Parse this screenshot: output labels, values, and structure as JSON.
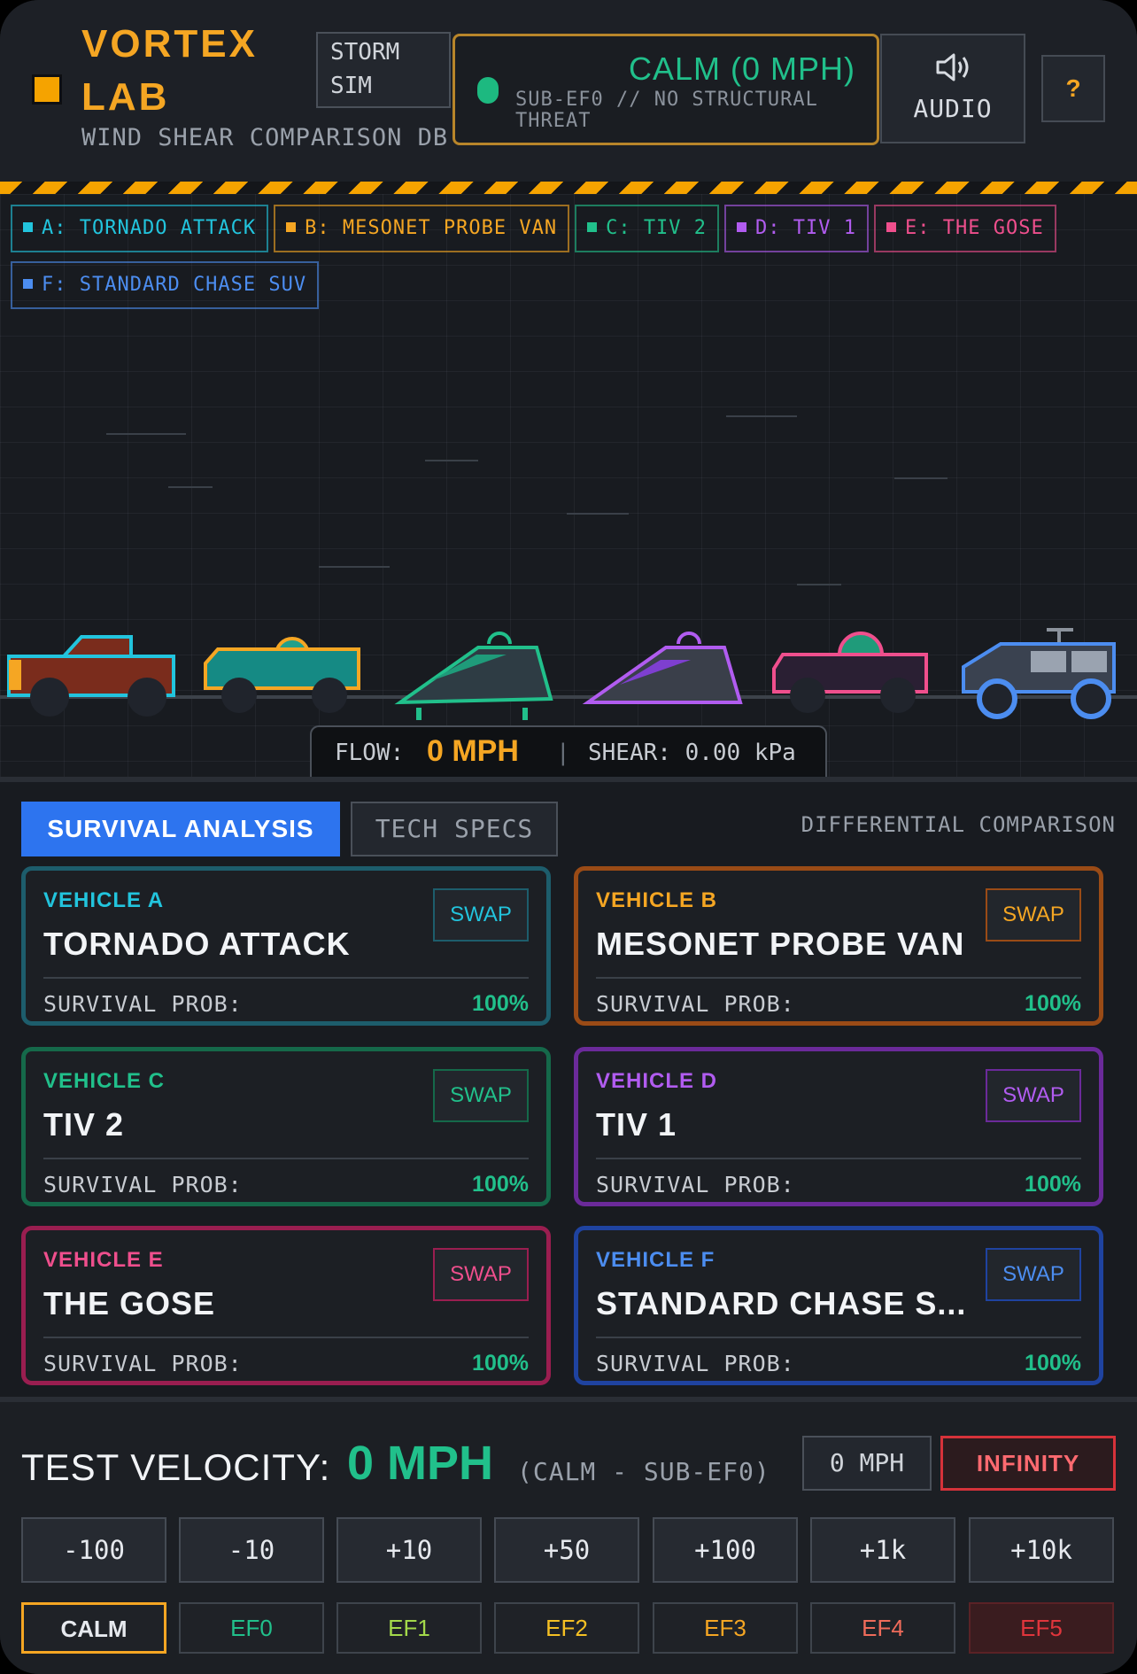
{
  "header": {
    "title": "VORTEX LAB",
    "subtitle": "WIND SHEAR COMPARISON DB",
    "storm_button": "STORM SIM",
    "status_main": "CALM (0 MPH)",
    "status_sub": "SUB-EF0 // NO STRUCTURAL THREAT",
    "audio_label": "AUDIO",
    "help_label": "?"
  },
  "legend": [
    {
      "label": "A: TORNADO ATTACK",
      "color": "#22c4dd"
    },
    {
      "label": "B: MESONET PROBE VAN",
      "color": "#f5a623"
    },
    {
      "label": "C: TIV 2",
      "color": "#21c08b"
    },
    {
      "label": "D: TIV 1",
      "color": "#b15cf0"
    },
    {
      "label": "E: THE GOSE",
      "color": "#ef4f8d"
    },
    {
      "label": "F: STANDARD CHASE SUV",
      "color": "#4c8df0"
    }
  ],
  "readout": {
    "flow_label": "FLOW:",
    "flow_value": "0 MPH",
    "separator": "|",
    "shear_label": "SHEAR: 0.00 kPa"
  },
  "tabs": {
    "survival": "SURVIVAL ANALYSIS",
    "specs": "TECH SPECS",
    "differential": "DIFFERENTIAL COMPARISON"
  },
  "cards": [
    {
      "slot": "VEHICLE A",
      "name": "TORNADO ATTACK",
      "swap": "SWAP",
      "prob_label": "SURVIVAL PROB:",
      "prob": "100%",
      "color": "#22c4dd",
      "border": "#1d5d6c"
    },
    {
      "slot": "VEHICLE B",
      "name": "MESONET PROBE VAN",
      "swap": "SWAP",
      "prob_label": "SURVIVAL PROB:",
      "prob": "100%",
      "color": "#f5a623",
      "border": "#9a4b16"
    },
    {
      "slot": "VEHICLE C",
      "name": "TIV 2",
      "swap": "SWAP",
      "prob_label": "SURVIVAL PROB:",
      "prob": "100%",
      "color": "#21c08b",
      "border": "#15694a"
    },
    {
      "slot": "VEHICLE D",
      "name": "TIV 1",
      "swap": "SWAP",
      "prob_label": "SURVIVAL PROB:",
      "prob": "100%",
      "color": "#b15cf0",
      "border": "#6b2a9a"
    },
    {
      "slot": "VEHICLE E",
      "name": "THE GOSE",
      "swap": "SWAP",
      "prob_label": "SURVIVAL PROB:",
      "prob": "100%",
      "color": "#ef4f8d",
      "border": "#9a1e50"
    },
    {
      "slot": "VEHICLE F",
      "name": "STANDARD CHASE S...",
      "swap": "SWAP",
      "prob_label": "SURVIVAL PROB:",
      "prob": "100%",
      "color": "#4c8df0",
      "border": "#1f43a0"
    }
  ],
  "footer": {
    "test_label": "TEST VELOCITY:",
    "test_value": "0 MPH",
    "test_category": "(CALM - SUB-EF0)",
    "mph_button": "0 MPH",
    "infinity_button": "INFINITY",
    "steps": [
      "-100",
      "-10",
      "+10",
      "+50",
      "+100",
      "+1k",
      "+10k"
    ],
    "presets": [
      {
        "label": "CALM",
        "color": "#e6e9ee",
        "border": "#f5a623",
        "bg": "#1f2227"
      },
      {
        "label": "EF0",
        "color": "#21c08b",
        "border": "#3e444c",
        "bg": "#1f2227"
      },
      {
        "label": "EF1",
        "color": "#a3d94a",
        "border": "#3e444c",
        "bg": "#1f2227"
      },
      {
        "label": "EF2",
        "color": "#f5c023",
        "border": "#3e444c",
        "bg": "#1f2227"
      },
      {
        "label": "EF3",
        "color": "#f5a623",
        "border": "#3e444c",
        "bg": "#1f2227"
      },
      {
        "label": "EF4",
        "color": "#ef6b5a",
        "border": "#3e444c",
        "bg": "#1f2227"
      },
      {
        "label": "EF5",
        "color": "#e0353c",
        "border": "#5a2226",
        "bg": "#3a1c1f"
      }
    ]
  }
}
